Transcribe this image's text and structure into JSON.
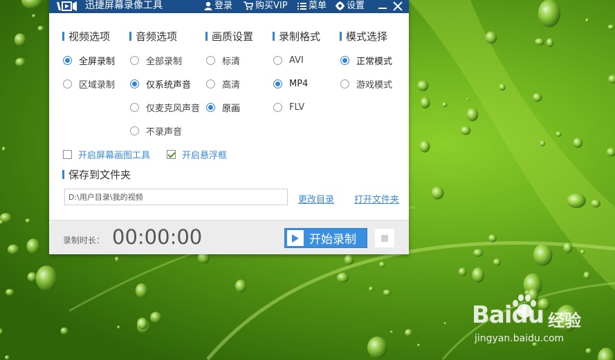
{
  "app": {
    "title": "迅捷屏幕录像工具",
    "titlebar": {
      "login": "登录",
      "buy_vip": "购买VIP",
      "menu": "菜单",
      "settings": "设置"
    },
    "accent_color": "#2f86d6",
    "titlebar_color": "#1b4f8c"
  },
  "sections": {
    "video": {
      "label": "视频选项",
      "options": [
        "全屏录制",
        "区域录制"
      ],
      "selected": "全屏录制"
    },
    "audio": {
      "label": "音频选项",
      "options": [
        "全部录制",
        "仅系统声音",
        "仅麦克风声音",
        "不录声音"
      ],
      "selected": "仅系统声音"
    },
    "quality": {
      "label": "画质设置",
      "options": [
        "标清",
        "高清",
        "原画"
      ],
      "selected": "原画"
    },
    "format": {
      "label": "录制格式",
      "options": [
        "AVI",
        "MP4",
        "FLV"
      ],
      "selected": "MP4"
    },
    "mode": {
      "label": "模式选择",
      "options": [
        "正常模式",
        "游戏模式"
      ],
      "selected": "正常模式"
    }
  },
  "checkboxes": {
    "drawing_tool": {
      "label": "开启屏幕画图工具",
      "checked": false
    },
    "floating_box": {
      "label": "开启悬浮框",
      "checked": true
    }
  },
  "save": {
    "label": "保存到文件夹",
    "path": "D:\\用户目录\\我的视频",
    "change_dir": "更改目录",
    "open_folder": "打开文件夹"
  },
  "recording": {
    "duration_label": "录制时长：",
    "duration": "00:00:00",
    "start_label": "开始录制"
  },
  "watermark": {
    "brand": "Baidu",
    "subtitle": "经验",
    "url": "jingyan.baidu.com"
  }
}
